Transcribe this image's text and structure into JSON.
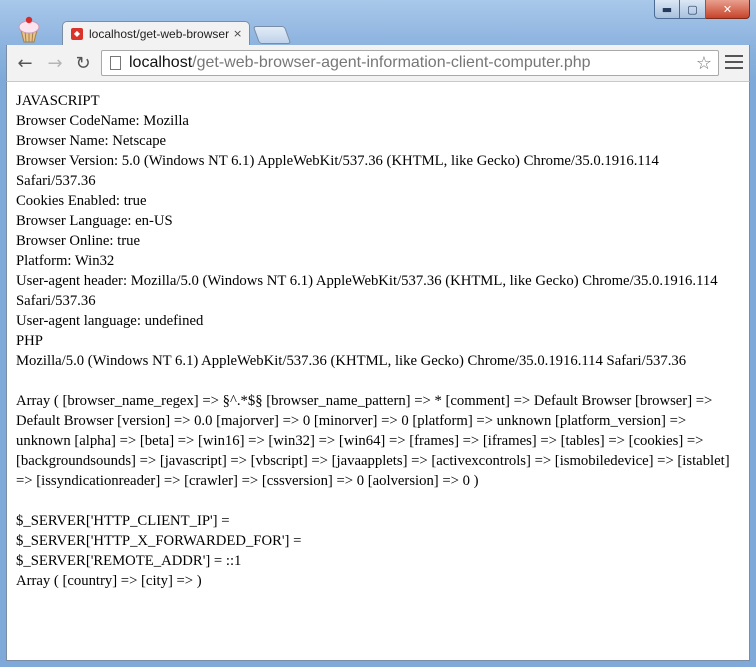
{
  "window": {
    "buttons": {
      "minimize": "▬",
      "maximize": "▢",
      "close": "✕"
    }
  },
  "tab": {
    "title": "localhost/get-web-browser-agent-information-client-computer.php",
    "close": "×"
  },
  "toolbar": {
    "back": "←",
    "forward": "→",
    "reload": "↻",
    "url_host": "localhost",
    "url_path": "/get-web-browser-agent-information-client-computer.php",
    "star": "☆"
  },
  "content": {
    "lines": [
      "JAVASCRIPT",
      "Browser CodeName: Mozilla",
      "Browser Name: Netscape",
      "Browser Version: 5.0 (Windows NT 6.1) AppleWebKit/537.36 (KHTML, like Gecko) Chrome/35.0.1916.114 Safari/537.36",
      "Cookies Enabled: true",
      "Browser Language: en-US",
      "Browser Online: true",
      "Platform: Win32",
      "User-agent header: Mozilla/5.0 (Windows NT 6.1) AppleWebKit/537.36 (KHTML, like Gecko) Chrome/35.0.1916.114 Safari/537.36",
      "User-agent language: undefined",
      "PHP",
      "Mozilla/5.0 (Windows NT 6.1) AppleWebKit/537.36 (KHTML, like Gecko) Chrome/35.0.1916.114 Safari/537.36"
    ],
    "array_dump": "Array ( [browser_name_regex] => §^.*$§ [browser_name_pattern] => * [comment] => Default Browser [browser] => Default Browser [version] => 0.0 [majorver] => 0 [minorver] => 0 [platform] => unknown [platform_version] => unknown [alpha] => [beta] => [win16] => [win32] => [win64] => [frames] => [iframes] => [tables] => [cookies] => [backgroundsounds] => [javascript] => [vbscript] => [javaapplets] => [activexcontrols] => [ismobiledevice] => [istablet] => [issyndicationreader] => [crawler] => [cssversion] => 0 [aolversion] => 0 )",
    "server_lines": [
      "$_SERVER['HTTP_CLIENT_IP'] =",
      "$_SERVER['HTTP_X_FORWARDED_FOR'] =",
      "$_SERVER['REMOTE_ADDR'] = ::1",
      "Array ( [country] => [city] => )"
    ]
  }
}
